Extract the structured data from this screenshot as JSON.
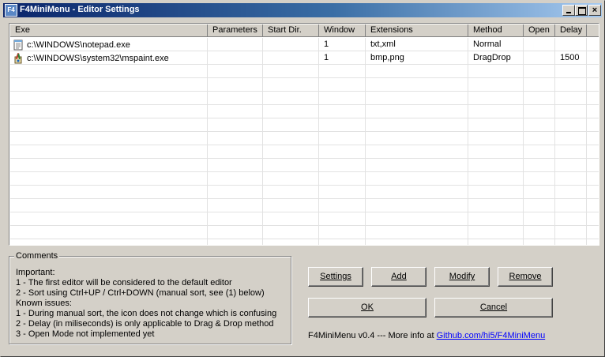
{
  "window": {
    "title": "F4MiniMenu - Editor Settings",
    "icon_text": "F4"
  },
  "list": {
    "columns": [
      "Exe",
      "Parameters",
      "Start Dir.",
      "Window",
      "Extensions",
      "Method",
      "Open",
      "Delay"
    ],
    "rows": [
      {
        "icon": "notepad-icon",
        "exe": "c:\\WINDOWS\\notepad.exe",
        "parameters": "",
        "start_dir": "",
        "window": "1",
        "extensions": "txt,xml",
        "method": "Normal",
        "open": "",
        "delay": ""
      },
      {
        "icon": "mspaint-icon",
        "exe": "c:\\WINDOWS\\system32\\mspaint.exe",
        "parameters": "",
        "start_dir": "",
        "window": "1",
        "extensions": "bmp,png",
        "method": "DragDrop",
        "open": "",
        "delay": "1500"
      }
    ]
  },
  "comments": {
    "title": "Comments",
    "lines": [
      "Important:",
      "1 - The first editor will be considered to the default editor",
      "2 - Sort using Ctrl+UP / Ctrl+DOWN (manual sort, see (1) below)",
      "Known issues:",
      "1 - During manual sort, the icon does not change which is confusing",
      "2 - Delay (in miliseconds) is only applicable to Drag & Drop method",
      "3 - Open Mode not implemented yet"
    ]
  },
  "buttons": {
    "settings": "Settings",
    "add": "Add",
    "modify": "Modify",
    "remove": "Remove",
    "ok": "OK",
    "cancel": "Cancel"
  },
  "footer": {
    "text": "F4MiniMenu v0.4 --- More info at ",
    "link": "Github.com/hi5/F4MiniMenu"
  }
}
